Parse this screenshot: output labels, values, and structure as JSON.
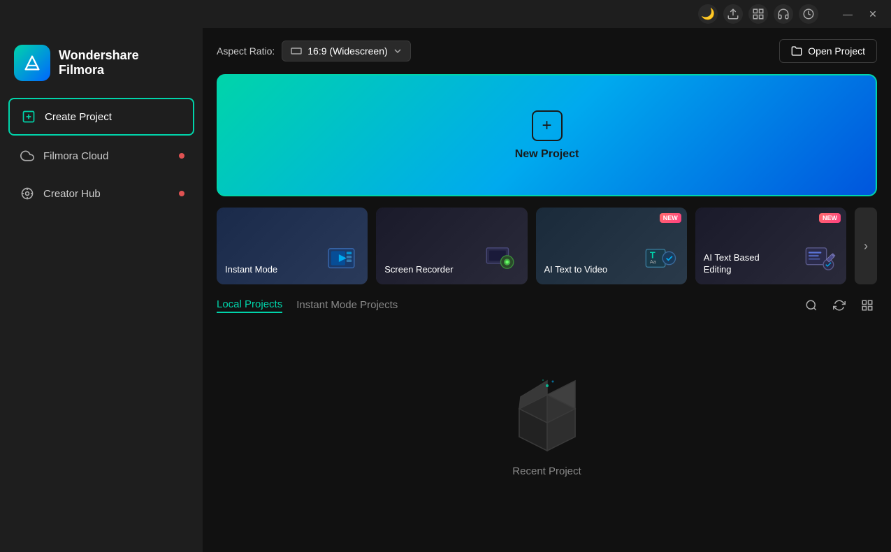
{
  "titlebar": {
    "icons": [
      {
        "name": "theme-icon",
        "symbol": "🌙"
      },
      {
        "name": "upload-icon",
        "symbol": "☁"
      },
      {
        "name": "grid-icon",
        "symbol": "⊞"
      },
      {
        "name": "headset-icon",
        "symbol": "🎧"
      },
      {
        "name": "timer-icon",
        "symbol": "⏱"
      }
    ],
    "minimize_label": "—",
    "close_label": "✕"
  },
  "sidebar": {
    "logo": {
      "name_line1": "Wondershare",
      "name_line2": "Filmora"
    },
    "nav_items": [
      {
        "id": "create-project",
        "label": "Create Project",
        "active": true,
        "dot": false
      },
      {
        "id": "filmora-cloud",
        "label": "Filmora Cloud",
        "active": false,
        "dot": true
      },
      {
        "id": "creator-hub",
        "label": "Creator Hub",
        "active": false,
        "dot": true
      }
    ]
  },
  "header": {
    "aspect_ratio_label": "Aspect Ratio:",
    "aspect_ratio_value": "16:9 (Widescreen)",
    "open_project_label": "Open Project"
  },
  "new_project": {
    "label": "New Project"
  },
  "quick_actions": [
    {
      "id": "instant-mode",
      "label": "Instant Mode",
      "has_badge": false,
      "badge_text": ""
    },
    {
      "id": "screen-recorder",
      "label": "Screen Recorder",
      "has_badge": false,
      "badge_text": ""
    },
    {
      "id": "ai-text-to-video",
      "label": "AI Text to Video",
      "has_badge": true,
      "badge_text": "NEW"
    },
    {
      "id": "ai-text-based-editing",
      "label": "AI Text Based Editing",
      "has_badge": true,
      "badge_text": "NEW"
    }
  ],
  "projects": {
    "tabs": [
      {
        "id": "local-projects",
        "label": "Local Projects",
        "active": true
      },
      {
        "id": "instant-mode-projects",
        "label": "Instant Mode Projects",
        "active": false
      }
    ],
    "actions": [
      {
        "id": "search",
        "symbol": "🔍"
      },
      {
        "id": "refresh",
        "symbol": "↻"
      },
      {
        "id": "grid-view",
        "symbol": "⊞"
      }
    ],
    "empty_state": {
      "label": "Recent Project"
    }
  }
}
